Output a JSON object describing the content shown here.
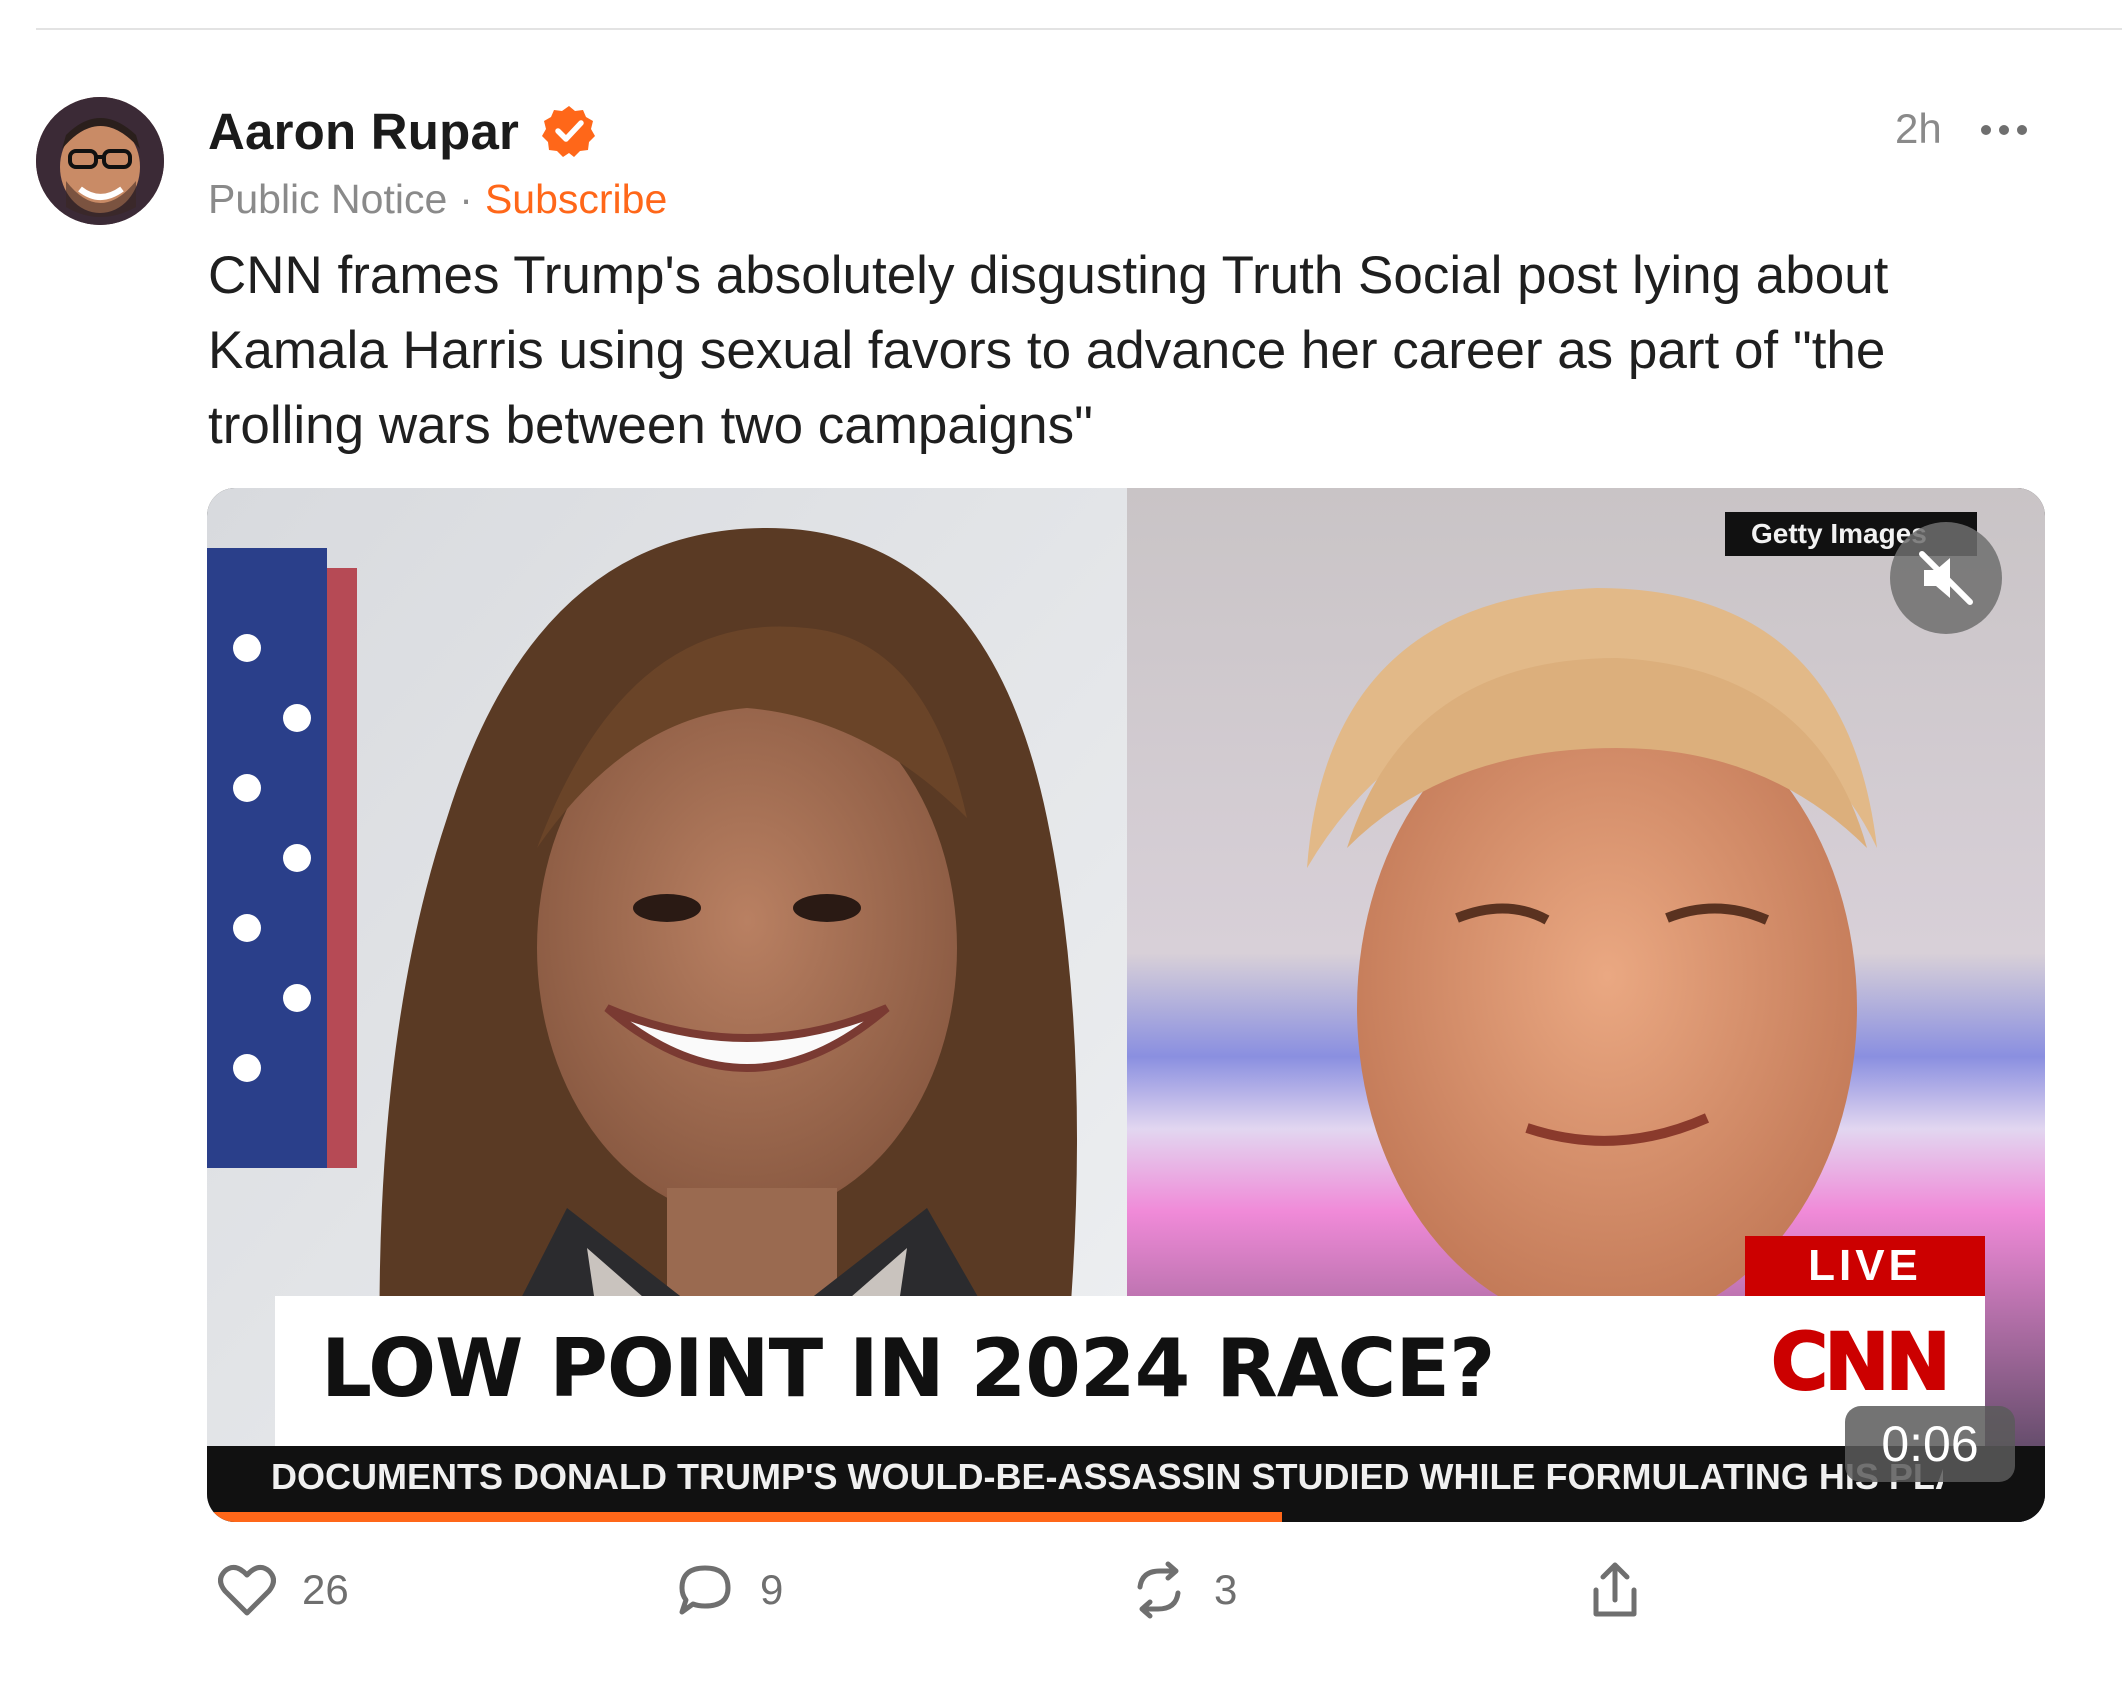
{
  "post": {
    "author_name": "Aaron Rupar",
    "publication": "Public Notice",
    "separator": "·",
    "subscribe_label": "Subscribe",
    "timestamp": "2h",
    "text": "CNN frames Trump's absolutely disgusting Truth Social post lying about Kamala Harris using sexual favors to advance her career as part of \"the trolling wars between two campaigns\""
  },
  "video": {
    "getty_credit": "Getty Images",
    "live_label": "LIVE",
    "network_logo": "CNN",
    "headline": "LOW POINT IN 2024 RACE?",
    "ticker": "DOCUMENTS DONALD TRUMP'S WOULD-BE-ASSASSIN STUDIED WHILE FORMULATING HIS PLAN   THE LEAD",
    "duration": "0:06",
    "progress_fraction": 0.585,
    "muted": true
  },
  "actions": {
    "likes": "26",
    "comments": "9",
    "restacks": "3"
  },
  "colors": {
    "accent": "#ff6719",
    "cnn_red": "#cc0000",
    "muted_text": "#8a8a8a"
  },
  "icons": [
    "verified-badge-icon",
    "more-icon",
    "mute-icon",
    "heart-icon",
    "comment-icon",
    "restack-icon",
    "share-icon"
  ]
}
